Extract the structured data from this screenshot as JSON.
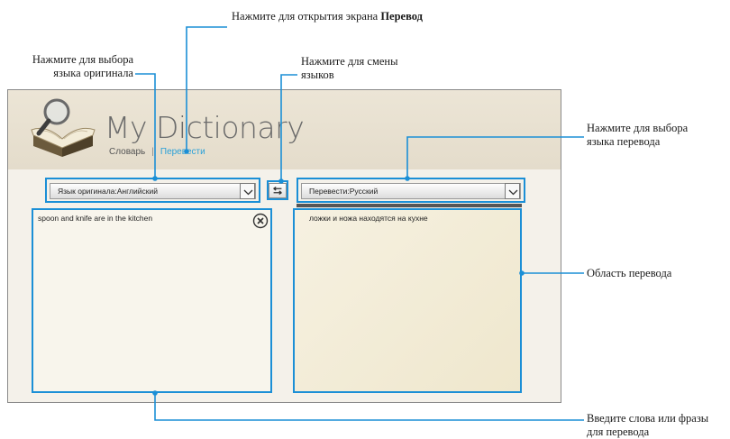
{
  "app": {
    "title": "My Dictionary",
    "tabs": {
      "dictionary": "Словарь",
      "separator": "|",
      "translate": "Перевести"
    }
  },
  "selectors": {
    "source_language": "Язык оригинала:Английский",
    "target_language": "Перевести:Русский"
  },
  "source": {
    "text": "spoon and knife are in the kitchen"
  },
  "result": {
    "text": "ложки и ножа находятся на кухне"
  },
  "callouts": {
    "open_translate_prefix": "Нажмите для открытия экрана ",
    "open_translate_bold": "Перевод",
    "source_lang_line1": "Нажмите для выбора",
    "source_lang_line2": "языка оригинала",
    "swap_line1": "Нажмите для смены",
    "swap_line2": "языков",
    "target_lang_line1": "Нажмите для выбора",
    "target_lang_line2": "языка перевода",
    "result_area": "Область перевода",
    "input_line1": "Введите слова или фразы",
    "input_line2": "для перевода"
  },
  "colors": {
    "accent": "#1b8fd6",
    "tab_active": "#2aa0d8"
  }
}
